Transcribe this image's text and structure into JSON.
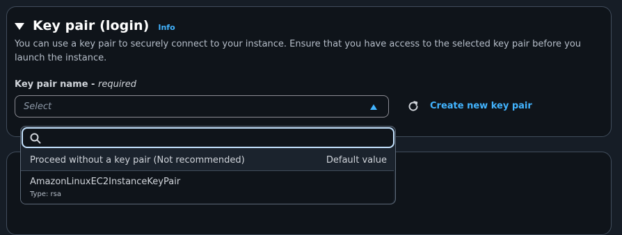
{
  "section": {
    "title": "Key pair (login)",
    "info_label": "Info",
    "description": "You can use a key pair to securely connect to your instance. Ensure that you have access to the selected key pair before you launch the instance."
  },
  "field": {
    "label": "Key pair name - ",
    "required_label": "required",
    "placeholder": "Select"
  },
  "create_link": "Create new key pair",
  "dropdown": {
    "search_value": "",
    "options": [
      {
        "label": "Proceed without a key pair (Not recommended)",
        "tag": "Default value"
      },
      {
        "label": "AmazonLinuxEC2InstanceKeyPair",
        "description": "Type: rsa"
      }
    ]
  },
  "colors": {
    "accent": "#42b4ff",
    "focus_ring": "#c6e4ff",
    "panel_bg": "#0f141a"
  }
}
